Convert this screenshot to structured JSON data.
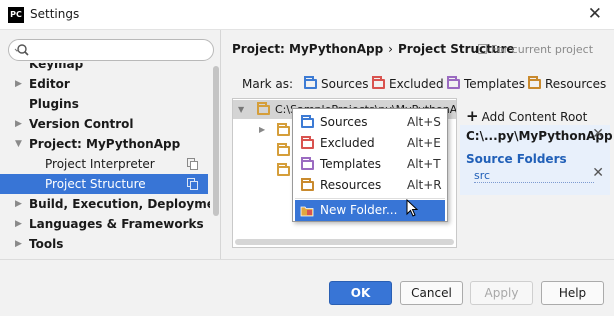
{
  "window": {
    "title": "Settings",
    "logo": "PC",
    "close_glyph": "✕"
  },
  "sidebar": {
    "search_placeholder": "",
    "items": [
      {
        "label": "Keymap",
        "arrow": ""
      },
      {
        "label": "Editor",
        "arrow": "▶"
      },
      {
        "label": "Plugins",
        "arrow": ""
      },
      {
        "label": "Version Control",
        "arrow": "▶"
      },
      {
        "label": "Project: MyPythonApp",
        "arrow": "▼"
      },
      {
        "label": "Project Interpreter",
        "arrow": ""
      },
      {
        "label": "Project Structure",
        "arrow": ""
      },
      {
        "label": "Build, Execution, Deployment",
        "arrow": "▶"
      },
      {
        "label": "Languages & Frameworks",
        "arrow": "▶"
      },
      {
        "label": "Tools",
        "arrow": "▶"
      }
    ]
  },
  "breadcrumb": {
    "parent": "Project: MyPythonApp",
    "separator": "›",
    "current": "Project Structure",
    "scope_note": "For current project"
  },
  "mark_as": {
    "label": "Mark as:",
    "sources": "Sources",
    "excluded": "Excluded",
    "templates": "Templates",
    "resources": "Resources"
  },
  "content_tree": {
    "root_path": "C:\\SampleProjects\\py\\MyPythonApp"
  },
  "context_menu": {
    "items": [
      {
        "label": "Sources",
        "shortcut": "Alt+S"
      },
      {
        "label": "Excluded",
        "shortcut": "Alt+E"
      },
      {
        "label": "Templates",
        "shortcut": "Alt+T"
      },
      {
        "label": "Resources",
        "shortcut": "Alt+R"
      },
      {
        "label": "New Folder...",
        "shortcut": ""
      }
    ]
  },
  "roots_panel": {
    "add_label": "Add Content Root",
    "root_name": "C:\\...py\\MyPythonApp",
    "source_folders_label": "Source Folders",
    "source_item": "src",
    "remove_glyph": "✕"
  },
  "footer": {
    "ok": "OK",
    "cancel": "Cancel",
    "apply": "Apply",
    "help": "Help"
  },
  "colors": {
    "selection": "#3875d6",
    "sources": "#3d7bd4",
    "excluded": "#d9534f",
    "templates": "#9b6bc1",
    "resources": "#c98a2e",
    "folder": "#d59e3a"
  }
}
